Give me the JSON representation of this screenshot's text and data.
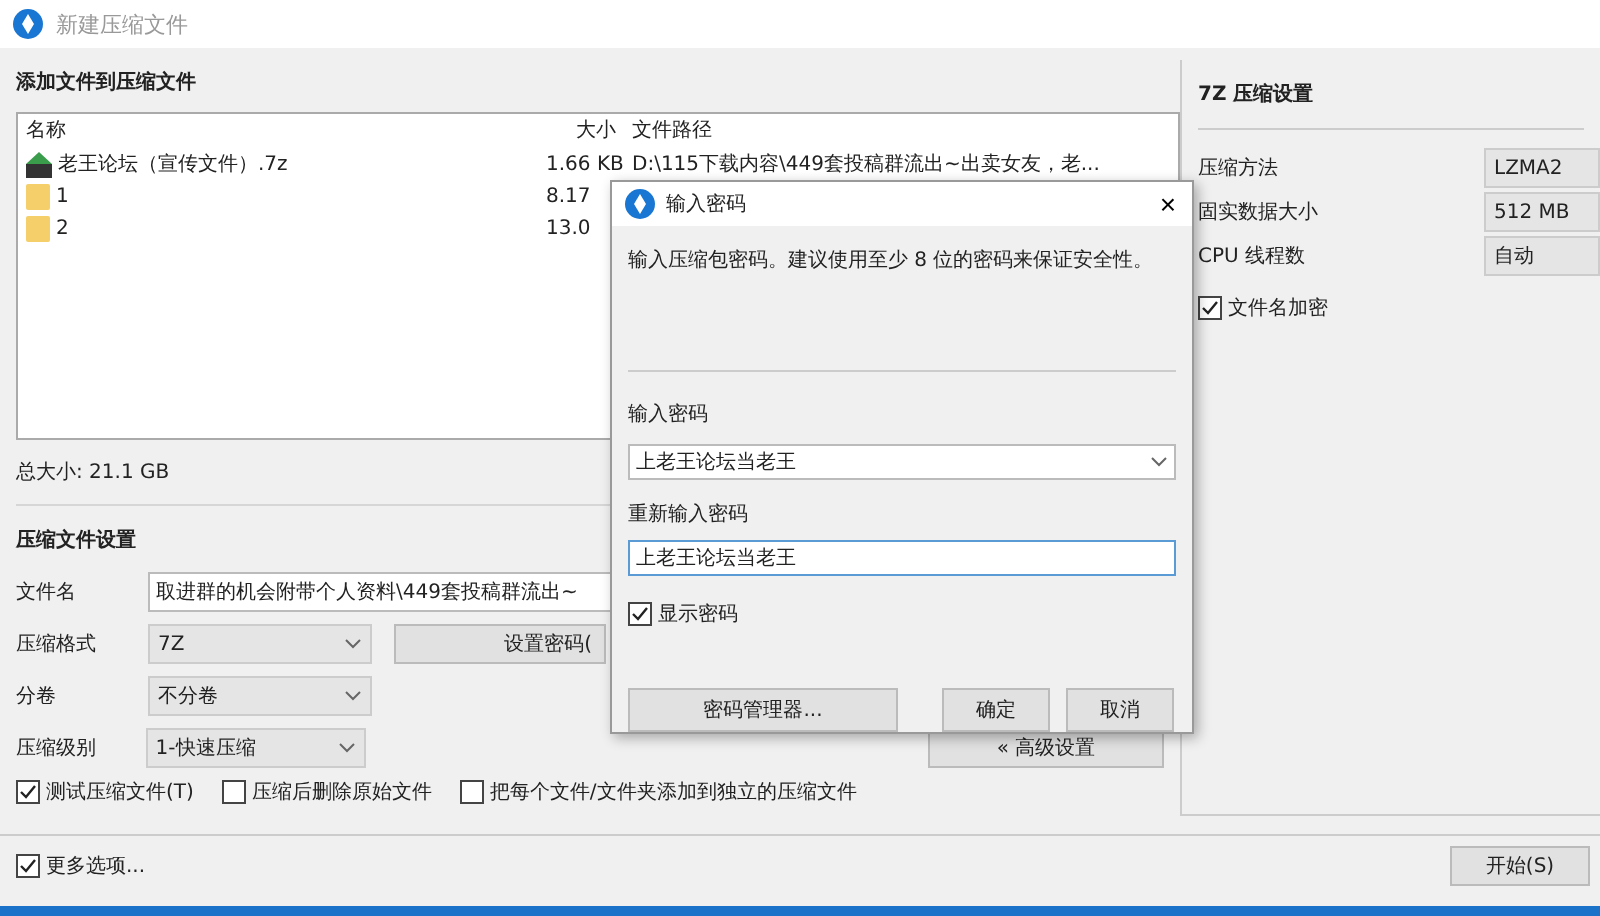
{
  "window": {
    "title": "新建压缩文件"
  },
  "files": {
    "heading": "添加文件到压缩文件",
    "columns": [
      "名称",
      "大小",
      "文件路径"
    ],
    "rows": [
      {
        "name": "老王论坛（宣传文件）.7z",
        "kind": "archive",
        "size": "1.66 KB",
        "path": "D:\\115下载内容\\449套投稿群流出~出卖女友，老..."
      },
      {
        "name": "1",
        "kind": "folder",
        "size": "8.17"
      },
      {
        "name": "2",
        "kind": "folder",
        "size": "13.0"
      }
    ],
    "total": "总大小: 21.1 GB"
  },
  "settings": {
    "heading": "压缩文件设置",
    "fields": [
      {
        "label": "文件名",
        "kind": "text",
        "value": "取进群的机会附带个人资料\\449套投稿群流出~"
      },
      {
        "label": "压缩格式",
        "kind": "combo",
        "value": "7Z",
        "button": "设置密码("
      },
      {
        "label": "分卷",
        "kind": "combo",
        "value": "不分卷"
      },
      {
        "label": "压缩级别",
        "kind": "combo",
        "value": "1-快速压缩",
        "button": "« 高级设置"
      }
    ],
    "options": [
      {
        "label": "测试压缩文件(T)",
        "checked": true
      },
      {
        "label": "压缩后删除原始文件",
        "checked": false
      },
      {
        "label": "把每个文件/文件夹添加到独立的压缩文件",
        "checked": false
      }
    ]
  },
  "more_options": {
    "label": "更多选项...",
    "checked": true
  },
  "start_button": "开始(S)",
  "seven_zip": {
    "heading": "7Z 压缩设置",
    "rows": [
      {
        "label": "压缩方法",
        "value": "LZMA2"
      },
      {
        "label": "固实数据大小",
        "value": "512 MB"
      },
      {
        "label": "CPU 线程数",
        "value": "自动"
      }
    ],
    "encrypt_names": {
      "label": "文件名加密",
      "checked": true
    }
  },
  "dialog": {
    "title": "输入密码",
    "close": "×",
    "hint": "输入压缩包密码。建议使用至少 8 位的密码来保证安全性。",
    "password_label": "输入密码",
    "password": "上老王论坛当老王",
    "confirm_label": "重新输入密码",
    "confirm": "上老王论坛当老王",
    "show_password": {
      "label": "显示密码",
      "checked": true
    },
    "buttons": [
      "密码管理器...",
      "确定",
      "取消"
    ]
  }
}
